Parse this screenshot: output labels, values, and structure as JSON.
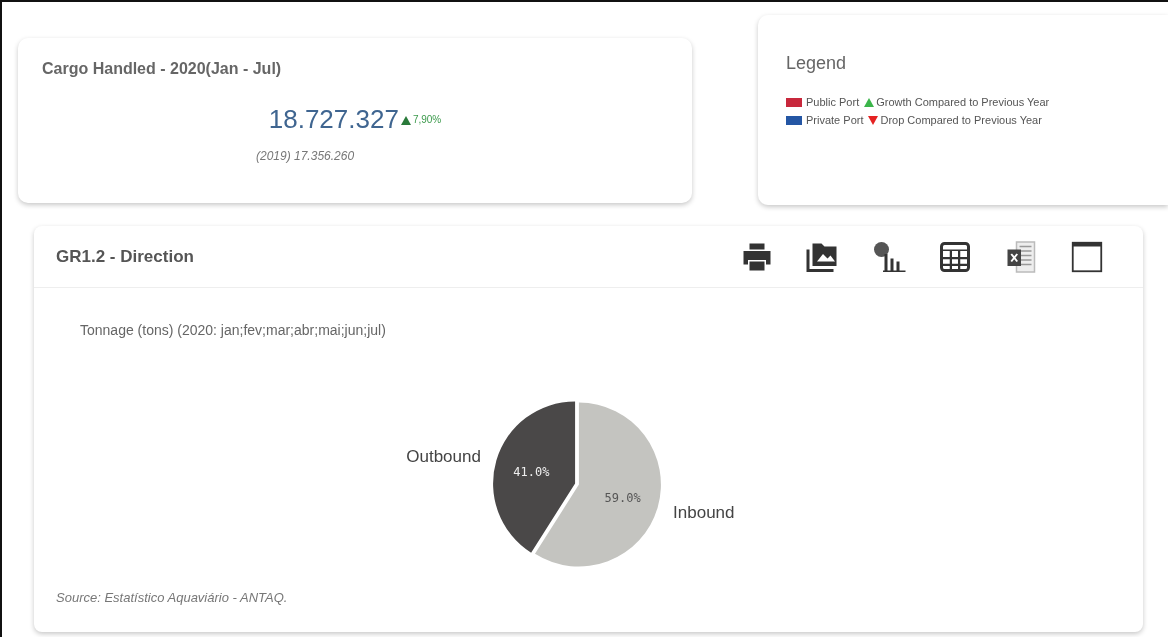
{
  "summary": {
    "title": "Cargo Handled - 2020(Jan - Jul)",
    "value": "18.727.327",
    "trend": {
      "kind": "up",
      "text": "7,90%"
    },
    "previous": "(2019) 17.356.260"
  },
  "legend": {
    "title": "Legend",
    "rows": [
      {
        "port": {
          "label": "Public Port",
          "color": "#c8283c"
        },
        "trend": {
          "kind": "up",
          "label": "Growth Compared to Previous Year"
        }
      },
      {
        "port": {
          "label": "Private Port",
          "color": "#2456a4"
        },
        "trend": {
          "kind": "down",
          "label": "Drop Compared to Previous Year"
        }
      }
    ]
  },
  "panel": {
    "title": "GR1.2 - Direction",
    "subtitle": "Tonnage (tons) (2020: jan;fev;mar;abr;mai;jun;jul)",
    "source": "Source: Estatístico Aquaviário - ANTAQ.",
    "chart_data": {
      "type": "pie",
      "categories": [
        "Outbound",
        "Inbound"
      ],
      "values": [
        41.0,
        59.0
      ],
      "value_labels": [
        "41.0%",
        "59.0%"
      ]
    }
  }
}
